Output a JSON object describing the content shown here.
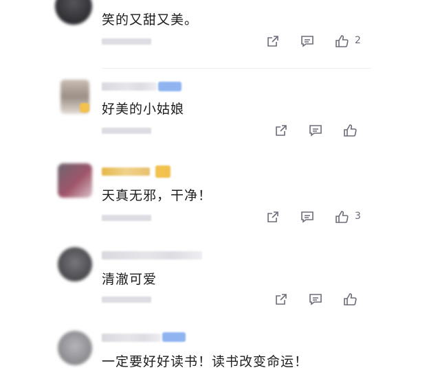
{
  "comments": [
    {
      "text": "笑的又甜又美。",
      "likes": "2",
      "avatar_color": "#3a3a3e"
    },
    {
      "text": "好美的小姑娘",
      "likes": "",
      "avatar_color": "#b9aaa0"
    },
    {
      "text": "天真无邪，干净！",
      "likes": "3",
      "avatar_color": "#a0556a"
    },
    {
      "text": "清澈可爱",
      "likes": "",
      "avatar_color": "#5a5a5e"
    },
    {
      "text": "一定要好好读书！读书改变命运！",
      "likes": "",
      "avatar_color": "#9a9a9e"
    }
  ],
  "icons": {
    "share": "share-icon",
    "reply": "reply-icon",
    "like": "thumbs-up-icon"
  },
  "colors": {
    "icon": "#6b6b78",
    "badge_blue": "#8fb4f0",
    "badge_gold": "#f2c14e"
  }
}
